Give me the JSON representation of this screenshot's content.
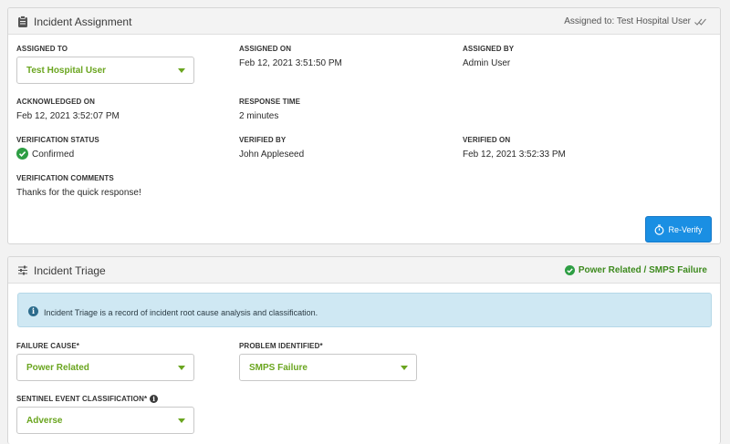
{
  "assignment": {
    "title": "Incident Assignment",
    "assigned_to_summary": "Assigned to: Test Hospital User",
    "assigned_to_label": "ASSIGNED TO",
    "assigned_to_value": "Test Hospital User",
    "assigned_on_label": "ASSIGNED ON",
    "assigned_on_value": "Feb 12, 2021 3:51:50 PM",
    "assigned_by_label": "ASSIGNED BY",
    "assigned_by_value": "Admin User",
    "acknowledged_on_label": "ACKNOWLEDGED ON",
    "acknowledged_on_value": "Feb 12, 2021 3:52:07 PM",
    "response_time_label": "RESPONSE TIME",
    "response_time_value": "2 minutes",
    "verification_status_label": "VERIFICATION STATUS",
    "verification_status_value": "Confirmed",
    "verified_by_label": "VERIFIED BY",
    "verified_by_value": "John Appleseed",
    "verified_on_label": "VERIFIED ON",
    "verified_on_value": "Feb 12, 2021 3:52:33 PM",
    "verification_comments_label": "VERIFICATION COMMENTS",
    "verification_comments_value": "Thanks for the quick response!",
    "reverify_label": "Re-Verify"
  },
  "triage": {
    "title": "Incident Triage",
    "summary": "Power Related / SMPS Failure",
    "info_text": "Incident Triage is a record of incident root cause analysis and classification.",
    "failure_cause_label": "FAILURE CAUSE*",
    "failure_cause_value": "Power Related",
    "problem_identified_label": "PROBLEM IDENTIFIED*",
    "problem_identified_value": "SMPS Failure",
    "sentinel_label": "SENTINEL EVENT CLASSIFICATION*",
    "sentinel_value": "Adverse"
  },
  "colors": {
    "accent_green": "#6aa51f",
    "status_green": "#2e9e44",
    "button_blue": "#1a8fe3",
    "info_bg": "#cfe8f3"
  }
}
